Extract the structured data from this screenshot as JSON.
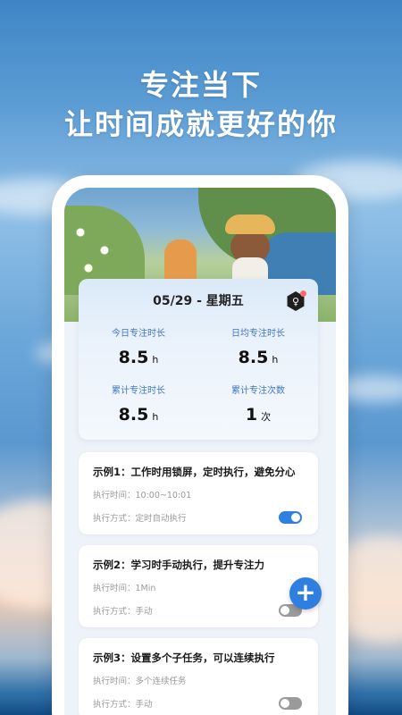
{
  "promo": {
    "line1": "专注当下",
    "line2": "让时间成就更好的你"
  },
  "stats": {
    "date": "05/29 - 星期五",
    "items": [
      {
        "label": "今日专注时长",
        "value": "8.5",
        "unit": "h"
      },
      {
        "label": "日均专注时长",
        "value": "8.5",
        "unit": "h"
      },
      {
        "label": "累计专注时长",
        "value": "8.5",
        "unit": "h"
      },
      {
        "label": "累计专注次数",
        "value": "1",
        "unit": "次"
      }
    ]
  },
  "tasks": [
    {
      "title": "示例1：工作时用锁屏，定时执行，避免分心",
      "time": "执行时间：10:00~10:01",
      "mode": "执行方式：定时自动执行",
      "enabled": true
    },
    {
      "title": "示例2：学习时手动执行，提升专注力",
      "time": "执行时间：1Min",
      "mode": "执行方式：手动",
      "enabled": false
    },
    {
      "title": "示例3：设置多个子任务，可以连续执行",
      "time": "执行时间：多个连续任务",
      "mode": "执行方式：手动",
      "enabled": false
    }
  ],
  "fab": {
    "label": "+"
  },
  "colors": {
    "accent": "#2f7fe0",
    "label_blue": "#3f78c0"
  }
}
